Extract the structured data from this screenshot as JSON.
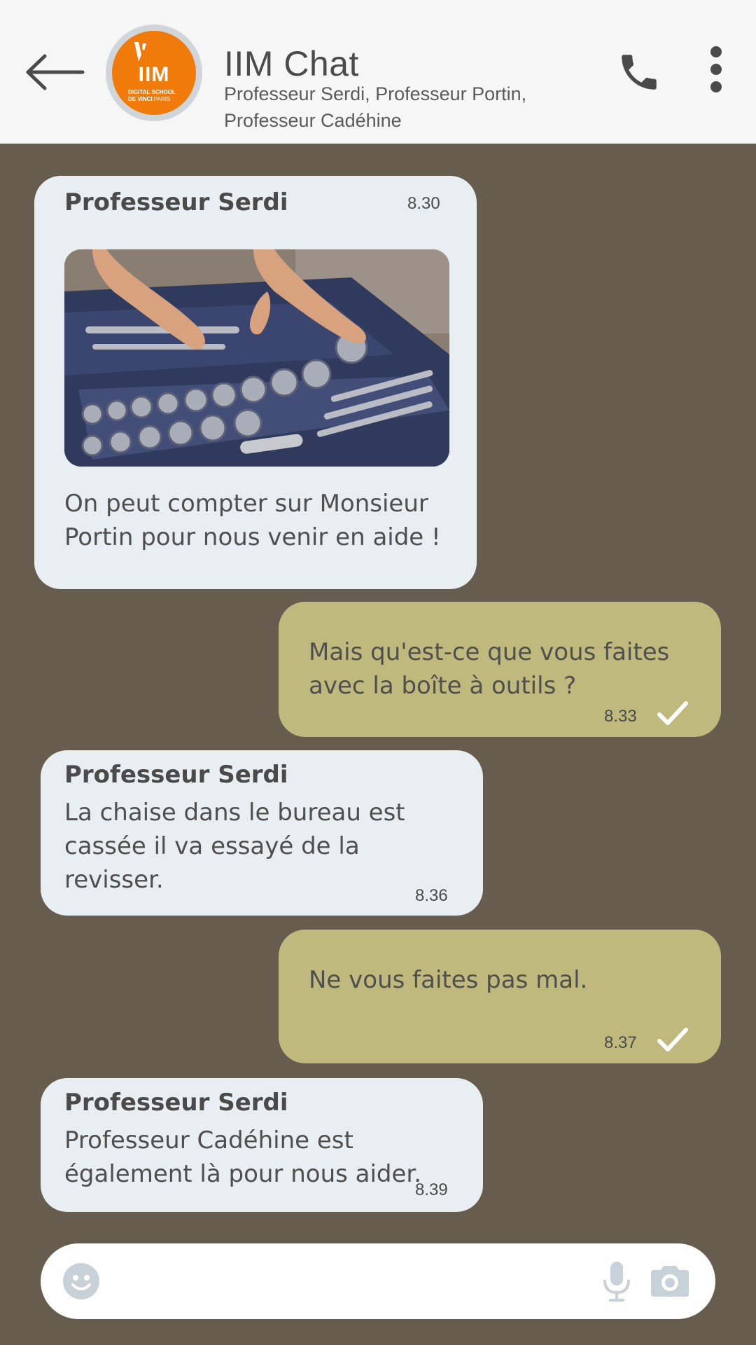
{
  "header": {
    "back_icon": "arrow-left-icon",
    "avatar": {
      "brand": "IIM",
      "line1": "DIGITAL SCHOOL",
      "line2a": "DE VINCI",
      "line2b": "PARIS",
      "color": "#F07B0A"
    },
    "title": "IIM Chat",
    "members": "Professeur Serdi, Professeur Portin, Professeur Cadéhine",
    "call_icon": "phone-icon",
    "menu_icon": "more-vertical-icon"
  },
  "messages": [
    {
      "direction": "incoming",
      "sender": "Professeur Serdi",
      "time": "8.30",
      "image": "toolbox-photo",
      "text": "On peut compter sur Monsieur Portin pour nous venir en aide !"
    },
    {
      "direction": "outgoing",
      "text": "Mais qu'est-ce que vous faites avec la boîte à outils ?",
      "time": "8.33",
      "status_icon": "check-icon"
    },
    {
      "direction": "incoming",
      "sender": "Professeur Serdi",
      "text": "La chaise dans le bureau est cassée il va essayé de la revisser.",
      "time": "8.36"
    },
    {
      "direction": "outgoing",
      "text": "Ne vous faites pas mal.",
      "time": "8.37",
      "status_icon": "check-icon"
    },
    {
      "direction": "incoming",
      "sender": "Professeur Serdi",
      "text": "Professeur Cadéhine est également là pour nous aider.",
      "time": "8.39"
    }
  ],
  "composer": {
    "value": "",
    "placeholder": "",
    "emoji_icon": "emoji-icon",
    "mic_icon": "microphone-icon",
    "camera_icon": "camera-icon"
  },
  "colors": {
    "background": "#675D4F",
    "header": "#F6F6F6",
    "incoming_bubble": "#E8EEF1",
    "outgoing_bubble": "#C0B97D"
  }
}
